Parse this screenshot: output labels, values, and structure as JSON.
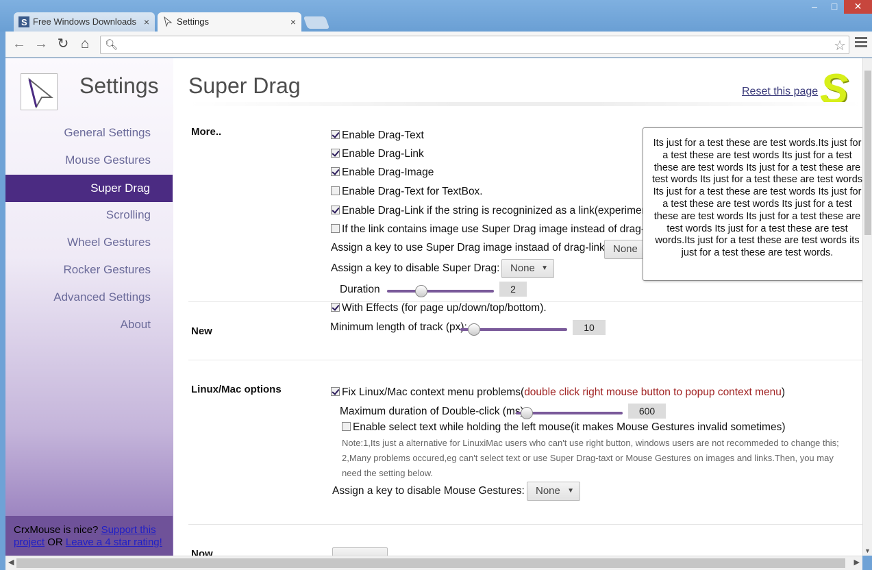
{
  "browser": {
    "tabs": [
      {
        "title": "Free Windows Downloads",
        "icon": "s-favicon"
      },
      {
        "title": "Settings",
        "icon": "crxmouse-favicon"
      }
    ],
    "close_glyph": "×",
    "window_controls": {
      "minimize": "–",
      "maximize": "□",
      "close": "✕"
    },
    "address": ""
  },
  "sidebar": {
    "title": "Settings",
    "items": [
      {
        "label": "General Settings"
      },
      {
        "label": "Mouse Gestures"
      },
      {
        "label": "Super Drag",
        "active": true
      },
      {
        "label": "Scrolling"
      },
      {
        "label": "Wheel Gestures"
      },
      {
        "label": "Rocker Gestures"
      },
      {
        "label": "Advanced Settings"
      },
      {
        "label": "About"
      }
    ],
    "footer": {
      "text1": "CrxMouse is nice?",
      "link1": "Support this project",
      "text2": "OR",
      "link2": "Leave a 4 star rating!"
    }
  },
  "main": {
    "title": "Super Drag",
    "reset_label": "Reset this page",
    "logo_letter": "S",
    "sections": {
      "more": {
        "label": "More..",
        "options": [
          {
            "label": "Enable Drag-Text",
            "checked": true
          },
          {
            "label": "Enable Drag-Link",
            "checked": true
          },
          {
            "label": "Enable Drag-Image",
            "checked": true
          },
          {
            "label": "Enable Drag-Text for TextBox.",
            "checked": false
          },
          {
            "label": "Enable Drag-Link if the string is recogninized as a link(experimental).",
            "checked": true
          },
          {
            "label": "If the link contains image use Super Drag image instead of drag-link",
            "checked": false
          }
        ],
        "assign_image_key_label": "Assign a key to use Super Drag image instaad of drag-link :",
        "assign_image_key_value": "None",
        "assign_disable_label": "Assign a key to disable Super Drag:",
        "assign_disable_value": "None",
        "duration_label": "Duration",
        "duration_value": "2",
        "duration_fraction": 0.3
      },
      "new": {
        "label": "New",
        "effects_label": "With Effects (for page up/down/top/bottom).",
        "effects_checked": true,
        "min_track_label": "Minimum length of track (px):",
        "min_track_value": "10",
        "min_track_fraction": 0.08
      },
      "linux": {
        "label": "Linux/Mac options",
        "fix_label": "Fix Linux/Mac context menu problems(",
        "fix_hint": "double click right mouse button to popup context menu",
        "fix_end": ")",
        "fix_checked": true,
        "max_dbl_label": "Maximum duration of Double-click (ms):",
        "max_dbl_value": "600",
        "max_dbl_fraction": 0.05,
        "select_text_label": "Enable select text while holding the left mouse(it makes Mouse Gestures invalid sometimes)",
        "select_text_checked": false,
        "note_line1": "Note:1,Its just a alternative for LinuxiMac users who can't use right button, windows users are not recommeded to change this;",
        "note_line2": "2,Many problems occured,eg can't select text or use Super Drag-taxt or Mouse Gestures on images and links.Then, you may",
        "note_line3": "need the setting below.",
        "assign_gestures_label": "Assign a key to disable Mouse Gestures:",
        "assign_gestures_value": "None"
      },
      "next": {
        "label": "Now"
      }
    },
    "tooltip": "Its just for a test these are test words.Its just for a test these are test words Its just for a test these are test words Its just for a test these are test words Its just for a test these are test words Its just for a test these are test words Its just for a test these are test words Its just for a test these are test words Its just for a test these are test words Its just for a test these are test words.Its just for a test these are test words its just for a test these are test words."
  },
  "colors": {
    "accent": "#4b2b82",
    "tooltip_red": "#a02222",
    "logo": "#d7ef1a"
  }
}
